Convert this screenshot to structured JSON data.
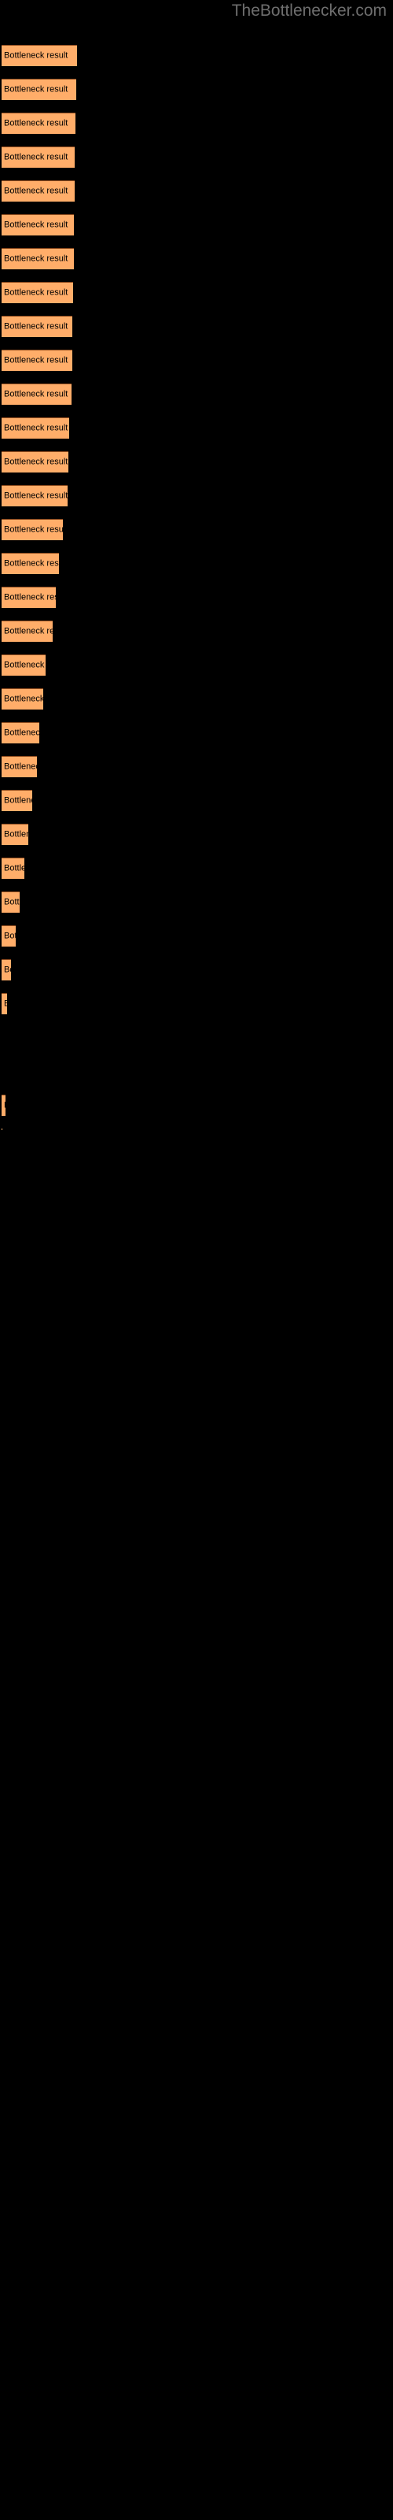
{
  "watermark": "TheBottlenecker.com",
  "bar_label": "Bottleneck result",
  "colors": {
    "background": "#000000",
    "bar_fill": "#ffad69",
    "bar_edge": "#8c4a1e",
    "label_text": "#000000",
    "watermark_text": "#6e6e6e"
  },
  "chart_data": {
    "type": "bar",
    "orientation": "horizontal",
    "title": "",
    "subtitle": "",
    "xlabel": "",
    "ylabel": "",
    "grid": false,
    "legend": null,
    "axis_visible": false,
    "tick_labels": [],
    "bar_count": 33,
    "categories": [
      "Bottleneck result",
      "Bottleneck result",
      "Bottleneck result",
      "Bottleneck result",
      "Bottleneck result",
      "Bottleneck result",
      "Bottleneck result",
      "Bottleneck result",
      "Bottleneck result",
      "Bottleneck result",
      "Bottleneck result",
      "Bottleneck result",
      "Bottleneck result",
      "Bottleneck result",
      "Bottleneck result",
      "Bottleneck result",
      "Bottleneck result",
      "Bottleneck result",
      "Bottleneck result",
      "Bottleneck result",
      "Bottleneck result",
      "Bottleneck result",
      "Bottleneck result",
      "Bottleneck result",
      "Bottleneck result",
      "Bottleneck result",
      "Bottleneck result",
      "Bottleneck result",
      "Bottleneck result",
      "Bottleneck result",
      "Bottleneck result",
      "Bottleneck result",
      "Bottleneck result"
    ],
    "values": [
      96,
      95,
      94,
      93,
      93,
      92,
      92,
      91,
      90,
      90,
      89,
      86,
      85,
      84,
      78,
      73,
      69,
      65,
      56,
      53,
      48,
      45,
      39,
      34,
      29,
      23,
      18,
      12,
      7,
      0,
      0,
      5,
      1
    ],
    "xlim": [
      0,
      100
    ],
    "unit": "px-width-proportion",
    "notes": "Horizontal bars descending in length; two zero-length slots near the end."
  },
  "bars": [
    {
      "y": 57,
      "w": 96,
      "h": 27,
      "label": "Bottleneck result"
    },
    {
      "y": 100,
      "w": 95,
      "h": 27,
      "label": "Bottleneck result"
    },
    {
      "y": 143,
      "w": 94,
      "h": 27,
      "label": "Bottleneck result"
    },
    {
      "y": 186,
      "w": 93,
      "h": 27,
      "label": "Bottleneck result"
    },
    {
      "y": 229,
      "w": 93,
      "h": 27,
      "label": "Bottleneck result"
    },
    {
      "y": 272,
      "w": 92,
      "h": 27,
      "label": "Bottleneck result"
    },
    {
      "y": 315,
      "w": 92,
      "h": 27,
      "label": "Bottleneck result"
    },
    {
      "y": 358,
      "w": 91,
      "h": 27,
      "label": "Bottleneck result"
    },
    {
      "y": 401,
      "w": 90,
      "h": 27,
      "label": "Bottleneck result"
    },
    {
      "y": 444,
      "w": 90,
      "h": 27,
      "label": "Bottleneck result"
    },
    {
      "y": 487,
      "w": 89,
      "h": 27,
      "label": "Bottleneck result"
    },
    {
      "y": 530,
      "w": 86,
      "h": 27,
      "label": "Bottleneck result"
    },
    {
      "y": 573,
      "w": 85,
      "h": 27,
      "label": "Bottleneck result"
    },
    {
      "y": 616,
      "w": 84,
      "h": 27,
      "label": "Bottleneck result"
    },
    {
      "y": 659,
      "w": 78,
      "h": 27,
      "label": "Bottleneck result"
    },
    {
      "y": 702,
      "w": 73,
      "h": 27,
      "label": "Bottleneck result"
    },
    {
      "y": 745,
      "w": 69,
      "h": 27,
      "label": "Bottleneck result"
    },
    {
      "y": 788,
      "w": 65,
      "h": 27,
      "label": "Bottleneck result"
    },
    {
      "y": 831,
      "w": 56,
      "h": 27,
      "label": "Bottleneck result"
    },
    {
      "y": 874,
      "w": 53,
      "h": 27,
      "label": "Bottleneck result"
    },
    {
      "y": 917,
      "w": 48,
      "h": 27,
      "label": "Bottleneck result"
    },
    {
      "y": 960,
      "w": 45,
      "h": 27,
      "label": "Bottleneck result"
    },
    {
      "y": 1003,
      "w": 39,
      "h": 27,
      "label": "Bottleneck result"
    },
    {
      "y": 1046,
      "w": 34,
      "h": 27,
      "label": "Bottleneck result"
    },
    {
      "y": 1089,
      "w": 29,
      "h": 27,
      "label": "Bottleneck result"
    },
    {
      "y": 1132,
      "w": 23,
      "h": 27,
      "label": "Bottleneck result"
    },
    {
      "y": 1175,
      "w": 18,
      "h": 27,
      "label": "Bottleneck result"
    },
    {
      "y": 1218,
      "w": 12,
      "h": 27,
      "label": "Bottleneck result"
    },
    {
      "y": 1261,
      "w": 7,
      "h": 27,
      "label": "Bottleneck result"
    },
    {
      "y": 1304,
      "w": 0,
      "h": 27,
      "label": "Bottleneck result"
    },
    {
      "y": 1347,
      "w": 0,
      "h": 27,
      "label": "Bottleneck result"
    },
    {
      "y": 1390,
      "w": 5,
      "h": 27,
      "label": "Bottleneck result"
    },
    {
      "y": 1433,
      "w": 1,
      "h": 2,
      "label": "Bottleneck result"
    }
  ]
}
